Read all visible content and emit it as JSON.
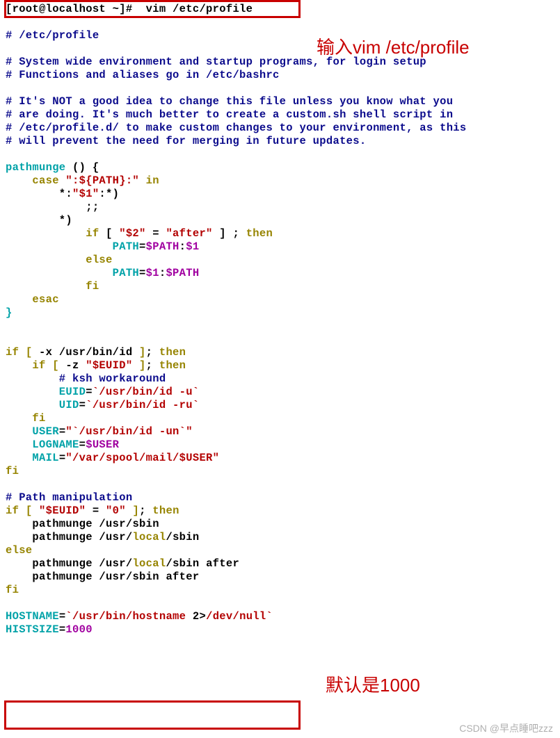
{
  "prompt": {
    "text": "[root@localhost ~]#  vim /etc/profile"
  },
  "annotations": {
    "top": "输入vim /etc/profile",
    "bottom": "默认是1000"
  },
  "watermark": "CSDN @早点睡吧zzz",
  "file": {
    "title_comment": "# /etc/profile",
    "summary": [
      "# System wide environment and startup programs, for login setup",
      "# Functions and aliases go in /etc/bashrc"
    ],
    "warning": [
      "# It's NOT a good idea to change this file unless you know what you",
      "# are doing. It's much better to create a custom.sh shell script in",
      "# /etc/profile.d/ to make custom changes to your environment, as this",
      "# will prevent the need for merging in future updates."
    ],
    "fn": {
      "decl_name": "pathmunge ",
      "decl_paren": "() ",
      "open": "{",
      "case_kw": "    case ",
      "case_str": "\":${PATH}:\"",
      "case_in": " in",
      "c1": "        *:",
      "c1_q": "\"$1\"",
      "c1_tail": ":*)",
      "s1": "            ;;",
      "c2": "        *)",
      "if_kw": "            if ",
      "if_lb": "[ ",
      "if_q1": "\"$2\"",
      "if_eq": " = ",
      "if_q2": "\"after\"",
      "if_rb": " ] ",
      "if_semi": "; ",
      "then": "then",
      "a1l": "                PATH",
      "eq": "=",
      "a1r1": "$PATH",
      "colon": ":",
      "a1r2": "$1",
      "else_kw": "            else",
      "a2l": "                PATH",
      "a2r1": "$1",
      "a2r2": "$PATH",
      "fi_kw": "            fi",
      "esac_kw": "    esac",
      "close": "}"
    },
    "id_block": {
      "if1_kw": "if ",
      "if1_lb": "[ ",
      "if1_flag": "-x ",
      "if1_path": "/usr/bin/id",
      "if1_rb": " ]",
      "if1_semi": "; ",
      "then": "then",
      "if2_pad": "    ",
      "if2_kw": "if ",
      "if2_lb": "[ ",
      "if2_flag": "-z ",
      "if2_q": "\"$EUID\"",
      "if2_rb": " ]",
      "if2_semi": "; ",
      "ksh_comment": "        # ksh workaround",
      "euid_l": "        EUID",
      "euid_r": "`/usr/bin/id -u`",
      "uid_l": "        UID",
      "uid_r": "`/usr/bin/id -ru`",
      "fi_inner": "    fi",
      "user_l": "    USER",
      "user_r": "\"`/usr/bin/id -un`\"",
      "logname_l": "    LOGNAME",
      "logname_r": "$USER",
      "mail_l": "    MAIL",
      "mail_r": "\"/var/spool/mail/$USER\"",
      "fi_outer": "fi"
    },
    "pathman": {
      "comment": "# Path manipulation",
      "if_kw": "if ",
      "lb": "[ ",
      "q1": "\"$EUID\"",
      "eq": " = ",
      "q2": "\"0\"",
      "rb": " ]",
      "semi": "; ",
      "then": "then",
      "p1": "    pathmunge ",
      "p_usr": "/usr/",
      "p_sbin": "sbin",
      "p_local": "local",
      "slash": "/",
      "else_kw": "else",
      "after": " after",
      "fi_kw": "fi"
    },
    "tail": {
      "host_l": "HOSTNAME",
      "host_r_bt1": "`",
      "host_r_path": "/usr/bin/hostname",
      "host_r_sp": " ",
      "host_r_num": "2",
      "host_r_gt": ">",
      "host_r_dev": "/dev/null",
      "host_r_bt2": "`",
      "hist_l": "HISTSIZE",
      "hist_r": "1000"
    }
  },
  "chart_data": null
}
